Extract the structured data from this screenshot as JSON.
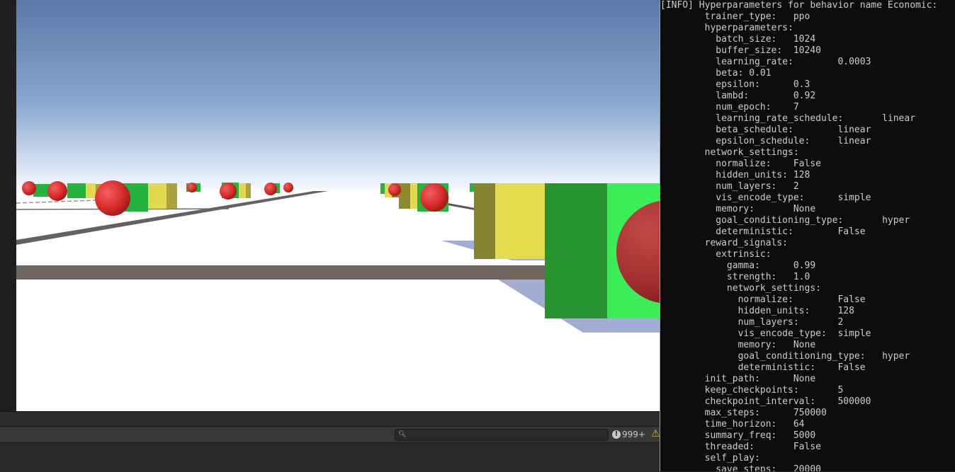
{
  "bottom_bar": {
    "search_placeholder": "",
    "error_count": "999+",
    "error_icon": "exclamation-circle-icon",
    "warning_icon": "warning-triangle-icon"
  },
  "game_view": {
    "sky_top": "#5a77a6",
    "sky_horizon": "#f7fbfe",
    "ground": "#ffffff",
    "sphere_color": "#e03a3a",
    "box_green": "#22b03d",
    "box_yellow": "#e2dc52"
  },
  "terminal": {
    "text_color": "#cccccc",
    "background": "#0c0c0c",
    "lines": [
      "[INFO] Hyperparameters for behavior name Economic:",
      "        trainer_type:   ppo",
      "        hyperparameters:",
      "          batch_size:   1024",
      "          buffer_size:  10240",
      "          learning_rate:        0.0003",
      "          beta: 0.01",
      "          epsilon:      0.3",
      "          lambd:        0.92",
      "          num_epoch:    7",
      "          learning_rate_schedule:       linear",
      "          beta_schedule:        linear",
      "          epsilon_schedule:     linear",
      "        network_settings:",
      "          normalize:    False",
      "          hidden_units: 128",
      "          num_layers:   2",
      "          vis_encode_type:      simple",
      "          memory:       None",
      "          goal_conditioning_type:       hyper",
      "          deterministic:        False",
      "        reward_signals:",
      "          extrinsic:",
      "            gamma:      0.99",
      "            strength:   1.0",
      "            network_settings:",
      "              normalize:        False",
      "              hidden_units:     128",
      "              num_layers:       2",
      "              vis_encode_type:  simple",
      "              memory:   None",
      "              goal_conditioning_type:   hyper",
      "              deterministic:    False",
      "        init_path:      None",
      "        keep_checkpoints:       5",
      "        checkpoint_interval:    500000",
      "        max_steps:      750000",
      "        time_horizon:   64",
      "        summary_freq:   5000",
      "        threaded:       False",
      "        self_play:",
      "          save_steps:   20000"
    ]
  }
}
